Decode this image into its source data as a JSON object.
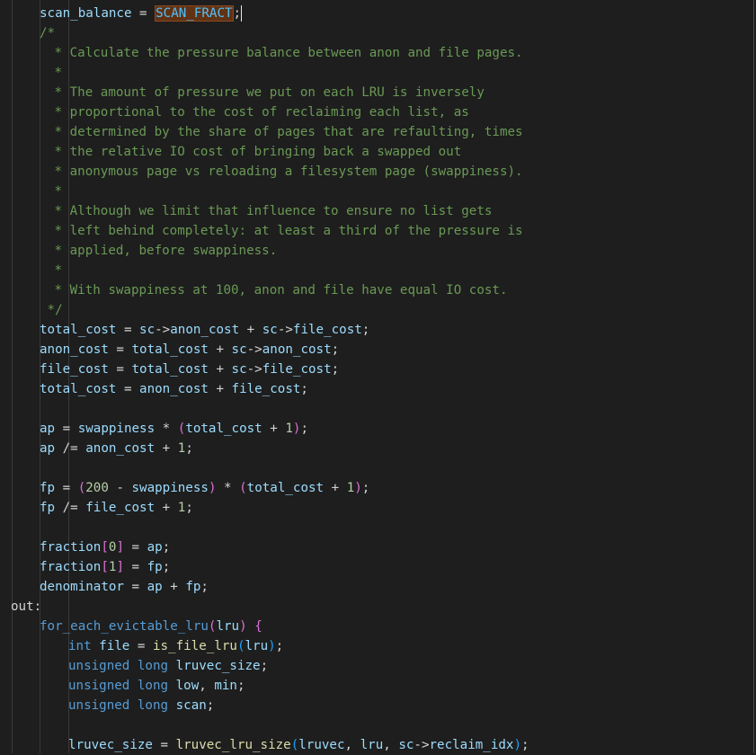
{
  "colors": {
    "background": "#1e1e1e",
    "comment": "#6a9955",
    "variable": "#9cdcfe",
    "number": "#b5cea8",
    "keyword_type": "#569cd6",
    "function": "#dcdcaa",
    "selection": "#613214"
  },
  "lines": [
    [
      {
        "t": "scan_balance",
        "c": "var"
      },
      {
        "t": " = ",
        "c": "op"
      },
      {
        "t": "SCAN_FRACT",
        "c": "macro",
        "sel": true
      },
      {
        "t": ";",
        "c": "op"
      },
      {
        "t": "",
        "c": "cursor"
      }
    ],
    [
      {
        "t": "/*",
        "c": "comment"
      }
    ],
    [
      {
        "t": " * Calculate the pressure balance between anon and file pages.",
        "c": "comment"
      }
    ],
    [
      {
        "t": " *",
        "c": "comment"
      }
    ],
    [
      {
        "t": " * The amount of pressure we put on each LRU is inversely",
        "c": "comment"
      }
    ],
    [
      {
        "t": " * proportional to the cost of reclaiming each list, as",
        "c": "comment"
      }
    ],
    [
      {
        "t": " * determined by the share of pages that are refaulting, times",
        "c": "comment"
      }
    ],
    [
      {
        "t": " * the relative IO cost of bringing back a swapped out",
        "c": "comment"
      }
    ],
    [
      {
        "t": " * anonymous page vs reloading a filesystem page (swappiness).",
        "c": "comment"
      }
    ],
    [
      {
        "t": " *",
        "c": "comment"
      }
    ],
    [
      {
        "t": " * Although we limit that influence to ensure no list gets",
        "c": "comment"
      }
    ],
    [
      {
        "t": " * left behind completely: at least a third of the pressure is",
        "c": "comment"
      }
    ],
    [
      {
        "t": " * applied, before swappiness.",
        "c": "comment"
      }
    ],
    [
      {
        "t": " *",
        "c": "comment"
      }
    ],
    [
      {
        "t": " * With swappiness at 100, anon and file have equal IO cost.",
        "c": "comment"
      }
    ],
    [
      {
        "t": " */",
        "c": "comment"
      }
    ],
    [
      {
        "t": "total_cost",
        "c": "var"
      },
      {
        "t": " = ",
        "c": "op"
      },
      {
        "t": "sc",
        "c": "var"
      },
      {
        "t": "->",
        "c": "op"
      },
      {
        "t": "anon_cost",
        "c": "var"
      },
      {
        "t": " + ",
        "c": "op"
      },
      {
        "t": "sc",
        "c": "var"
      },
      {
        "t": "->",
        "c": "op"
      },
      {
        "t": "file_cost",
        "c": "var"
      },
      {
        "t": ";",
        "c": "op"
      }
    ],
    [
      {
        "t": "anon_cost",
        "c": "var"
      },
      {
        "t": " = ",
        "c": "op"
      },
      {
        "t": "total_cost",
        "c": "var"
      },
      {
        "t": " + ",
        "c": "op"
      },
      {
        "t": "sc",
        "c": "var"
      },
      {
        "t": "->",
        "c": "op"
      },
      {
        "t": "anon_cost",
        "c": "var"
      },
      {
        "t": ";",
        "c": "op"
      }
    ],
    [
      {
        "t": "file_cost",
        "c": "var"
      },
      {
        "t": " = ",
        "c": "op"
      },
      {
        "t": "total_cost",
        "c": "var"
      },
      {
        "t": " + ",
        "c": "op"
      },
      {
        "t": "sc",
        "c": "var"
      },
      {
        "t": "->",
        "c": "op"
      },
      {
        "t": "file_cost",
        "c": "var"
      },
      {
        "t": ";",
        "c": "op"
      }
    ],
    [
      {
        "t": "total_cost",
        "c": "var"
      },
      {
        "t": " = ",
        "c": "op"
      },
      {
        "t": "anon_cost",
        "c": "var"
      },
      {
        "t": " + ",
        "c": "op"
      },
      {
        "t": "file_cost",
        "c": "var"
      },
      {
        "t": ";",
        "c": "op"
      }
    ],
    [],
    [
      {
        "t": "ap",
        "c": "var"
      },
      {
        "t": " = ",
        "c": "op"
      },
      {
        "t": "swappiness",
        "c": "var"
      },
      {
        "t": " * ",
        "c": "op"
      },
      {
        "t": "(",
        "c": "bracket2"
      },
      {
        "t": "total_cost",
        "c": "var"
      },
      {
        "t": " + ",
        "c": "op"
      },
      {
        "t": "1",
        "c": "num"
      },
      {
        "t": ")",
        "c": "bracket2"
      },
      {
        "t": ";",
        "c": "op"
      }
    ],
    [
      {
        "t": "ap",
        "c": "var"
      },
      {
        "t": " /= ",
        "c": "op"
      },
      {
        "t": "anon_cost",
        "c": "var"
      },
      {
        "t": " + ",
        "c": "op"
      },
      {
        "t": "1",
        "c": "num"
      },
      {
        "t": ";",
        "c": "op"
      }
    ],
    [],
    [
      {
        "t": "fp",
        "c": "var"
      },
      {
        "t": " = ",
        "c": "op"
      },
      {
        "t": "(",
        "c": "bracket2"
      },
      {
        "t": "200",
        "c": "num"
      },
      {
        "t": " - ",
        "c": "op"
      },
      {
        "t": "swappiness",
        "c": "var"
      },
      {
        "t": ")",
        "c": "bracket2"
      },
      {
        "t": " * ",
        "c": "op"
      },
      {
        "t": "(",
        "c": "bracket2"
      },
      {
        "t": "total_cost",
        "c": "var"
      },
      {
        "t": " + ",
        "c": "op"
      },
      {
        "t": "1",
        "c": "num"
      },
      {
        "t": ")",
        "c": "bracket2"
      },
      {
        "t": ";",
        "c": "op"
      }
    ],
    [
      {
        "t": "fp",
        "c": "var"
      },
      {
        "t": " /= ",
        "c": "op"
      },
      {
        "t": "file_cost",
        "c": "var"
      },
      {
        "t": " + ",
        "c": "op"
      },
      {
        "t": "1",
        "c": "num"
      },
      {
        "t": ";",
        "c": "op"
      }
    ],
    [],
    [
      {
        "t": "fraction",
        "c": "var"
      },
      {
        "t": "[",
        "c": "bracket2"
      },
      {
        "t": "0",
        "c": "num"
      },
      {
        "t": "]",
        "c": "bracket2"
      },
      {
        "t": " = ",
        "c": "op"
      },
      {
        "t": "ap",
        "c": "var"
      },
      {
        "t": ";",
        "c": "op"
      }
    ],
    [
      {
        "t": "fraction",
        "c": "var"
      },
      {
        "t": "[",
        "c": "bracket2"
      },
      {
        "t": "1",
        "c": "num"
      },
      {
        "t": "]",
        "c": "bracket2"
      },
      {
        "t": " = ",
        "c": "op"
      },
      {
        "t": "fp",
        "c": "var"
      },
      {
        "t": ";",
        "c": "op"
      }
    ],
    [
      {
        "t": "denominator",
        "c": "var"
      },
      {
        "t": " = ",
        "c": "op"
      },
      {
        "t": "ap",
        "c": "var"
      },
      {
        "t": " + ",
        "c": "op"
      },
      {
        "t": "fp",
        "c": "var"
      },
      {
        "t": ";",
        "c": "op"
      }
    ],
    [
      {
        "t": "out",
        "c": "label"
      },
      {
        "t": ":",
        "c": "op"
      }
    ],
    [
      {
        "t": "for_each_evictable_lru",
        "c": "type"
      },
      {
        "t": "(",
        "c": "bracket2"
      },
      {
        "t": "lru",
        "c": "var"
      },
      {
        "t": ")",
        "c": "bracket2"
      },
      {
        "t": " ",
        "c": "op"
      },
      {
        "t": "{",
        "c": "bracket2"
      }
    ],
    [
      {
        "t": "int",
        "c": "type"
      },
      {
        "t": " ",
        "c": "op"
      },
      {
        "t": "file",
        "c": "var"
      },
      {
        "t": " = ",
        "c": "op"
      },
      {
        "t": "is_file_lru",
        "c": "func"
      },
      {
        "t": "(",
        "c": "bracket3"
      },
      {
        "t": "lru",
        "c": "var"
      },
      {
        "t": ")",
        "c": "bracket3"
      },
      {
        "t": ";",
        "c": "op"
      }
    ],
    [
      {
        "t": "unsigned",
        "c": "type"
      },
      {
        "t": " ",
        "c": "op"
      },
      {
        "t": "long",
        "c": "type"
      },
      {
        "t": " ",
        "c": "op"
      },
      {
        "t": "lruvec_size",
        "c": "var"
      },
      {
        "t": ";",
        "c": "op"
      }
    ],
    [
      {
        "t": "unsigned",
        "c": "type"
      },
      {
        "t": " ",
        "c": "op"
      },
      {
        "t": "long",
        "c": "type"
      },
      {
        "t": " ",
        "c": "op"
      },
      {
        "t": "low",
        "c": "var"
      },
      {
        "t": ", ",
        "c": "op"
      },
      {
        "t": "min",
        "c": "var"
      },
      {
        "t": ";",
        "c": "op"
      }
    ],
    [
      {
        "t": "unsigned",
        "c": "type"
      },
      {
        "t": " ",
        "c": "op"
      },
      {
        "t": "long",
        "c": "type"
      },
      {
        "t": " ",
        "c": "op"
      },
      {
        "t": "scan",
        "c": "var"
      },
      {
        "t": ";",
        "c": "op"
      }
    ],
    [],
    [
      {
        "t": "lruvec_size",
        "c": "var"
      },
      {
        "t": " = ",
        "c": "op"
      },
      {
        "t": "lruvec_lru_size",
        "c": "func"
      },
      {
        "t": "(",
        "c": "bracket3"
      },
      {
        "t": "lruvec",
        "c": "var"
      },
      {
        "t": ", ",
        "c": "op"
      },
      {
        "t": "lru",
        "c": "var"
      },
      {
        "t": ", ",
        "c": "op"
      },
      {
        "t": "sc",
        "c": "var"
      },
      {
        "t": "->",
        "c": "op"
      },
      {
        "t": "reclaim_idx",
        "c": "var"
      },
      {
        "t": ")",
        "c": "bracket3"
      },
      {
        "t": ";",
        "c": "op"
      }
    ]
  ]
}
